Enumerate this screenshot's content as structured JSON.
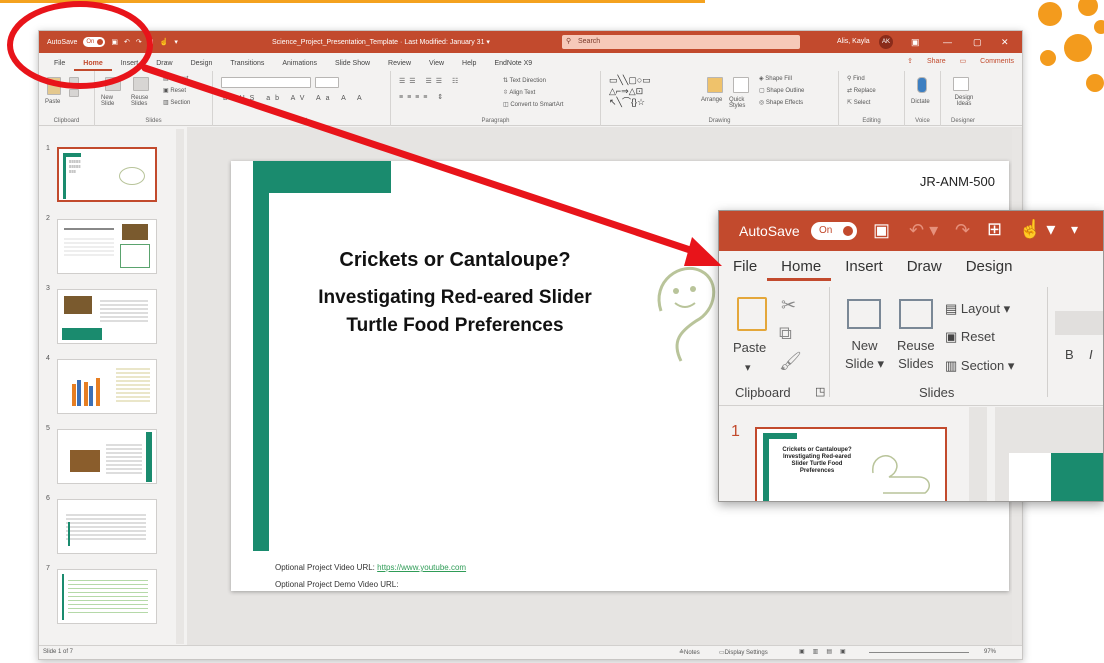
{
  "titlebar": {
    "autosave_label": "AutoSave",
    "autosave_state": "On",
    "filename": "Science_Project_Presentation_Template",
    "last_modified": "Last Modified: January 31",
    "search_placeholder": "Search",
    "user_name": "Alis, Kayla",
    "user_initials": "AK"
  },
  "menu": {
    "tabs": [
      "File",
      "Home",
      "Insert",
      "Draw",
      "Design",
      "Transitions",
      "Animations",
      "Slide Show",
      "Review",
      "View",
      "Help",
      "EndNote X9"
    ],
    "active": "Home",
    "share": "Share",
    "comments": "Comments"
  },
  "ribbon": {
    "groups": [
      "Clipboard",
      "Slides",
      "Font",
      "Paragraph",
      "Drawing",
      "Editing",
      "Voice",
      "Designer"
    ],
    "paste": "Paste",
    "new_slide": "New Slide",
    "reuse_slides": "Reuse Slides",
    "layout": "Layout",
    "reset": "Reset",
    "section": "Section",
    "find": "Find",
    "replace": "Replace",
    "select": "Select",
    "dictate": "Dictate",
    "design_ideas": "Design Ideas",
    "arrange": "Arrange",
    "quick_styles": "Quick Styles",
    "shape_fill": "Shape Fill",
    "shape_outline": "Shape Outline",
    "shape_effects": "Shape Effects",
    "text_direction": "Text Direction",
    "align_text": "Align Text",
    "convert_smartart": "Convert to SmartArt"
  },
  "thumbnails": [
    "1",
    "2",
    "3",
    "4",
    "5",
    "6",
    "7"
  ],
  "slide": {
    "code": "JR-ANM-500",
    "title": "Crickets or Cantaloupe?",
    "subtitle": "Investigating Red-eared Slider Turtle Food Preferences",
    "video_label": "Optional Project Video URL:",
    "video_url": "https://www.youtube.com",
    "demo_label": "Optional Project Demo Video URL:"
  },
  "status": {
    "slide_count": "Slide 1 of 7",
    "notes": "Notes",
    "display_settings": "Display Settings",
    "zoom": "97%"
  },
  "zoom_view": {
    "autosave_label": "AutoSave",
    "autosave_state": "On",
    "tabs": [
      "File",
      "Home",
      "Insert",
      "Draw",
      "Design"
    ],
    "active_tab": "Home",
    "paste": "Paste",
    "new": "New",
    "slide": "Slide",
    "reuse": "Reuse",
    "slides": "Slides",
    "layout": "Layout",
    "reset": "Reset",
    "section": "Section",
    "clipboard": "Clipboard",
    "slides_group": "Slides",
    "thumb_number": "1",
    "thumb_title": "Crickets or Cantaloupe? Investigating Red-eared Slider Turtle Food Preferences"
  },
  "colors": {
    "accent": "#c24a2d",
    "teal": "#1a8b6e",
    "annotation": "#e8141a",
    "orange": "#f39b1d"
  }
}
